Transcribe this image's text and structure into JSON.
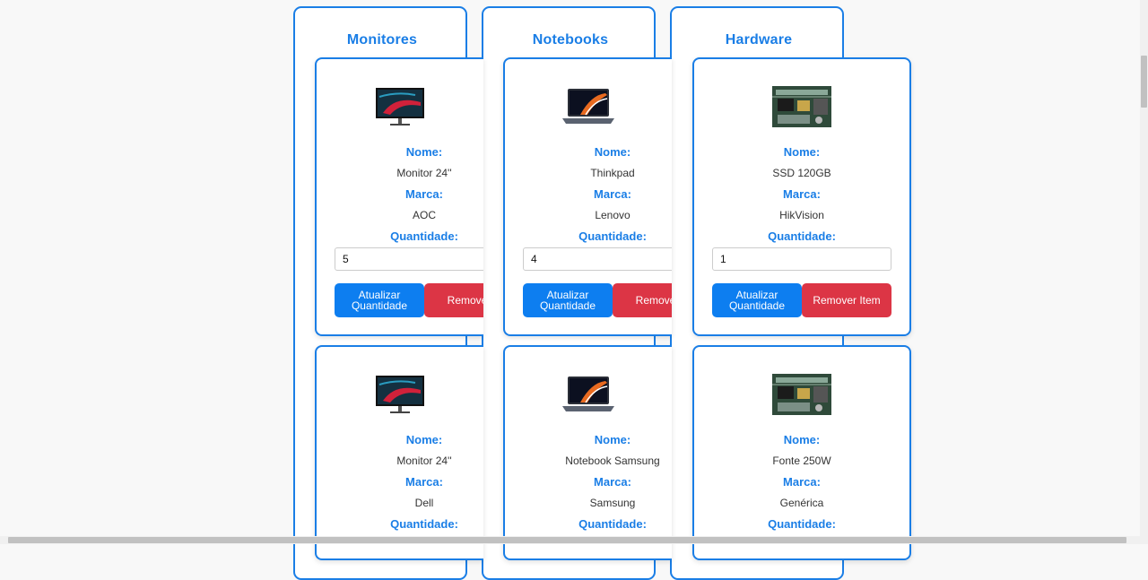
{
  "labels": {
    "name": "Nome:",
    "brand": "Marca:",
    "quantity": "Quantidade:"
  },
  "buttons": {
    "update": "Atualizar Quantidade",
    "remove_full": "Remover Item",
    "remove_clipped": "Remover"
  },
  "categories": [
    {
      "title": "Monitores"
    },
    {
      "title": "Notebooks"
    },
    {
      "title": "Hardware"
    }
  ],
  "cards": [
    {
      "image": "monitor-icon",
      "name": "Monitor 24''",
      "brand": "AOC",
      "quantity": "5"
    },
    {
      "image": "laptop-icon",
      "name": "Thinkpad",
      "brand": "Lenovo",
      "quantity": "4"
    },
    {
      "image": "circuit-board-icon",
      "name": "SSD 120GB",
      "brand": "HikVision",
      "quantity": "1"
    },
    {
      "image": "monitor-icon",
      "name": "Monitor 24''",
      "brand": "Dell"
    },
    {
      "image": "laptop-icon",
      "name": "Notebook Samsung",
      "brand": "Samsung"
    },
    {
      "image": "circuit-board-icon",
      "name": "Fonte 250W",
      "brand": "Genérica"
    }
  ],
  "colors": {
    "accent": "#1a7ee6",
    "update_button": "#0d7ef0",
    "remove_button": "#dc3545"
  }
}
